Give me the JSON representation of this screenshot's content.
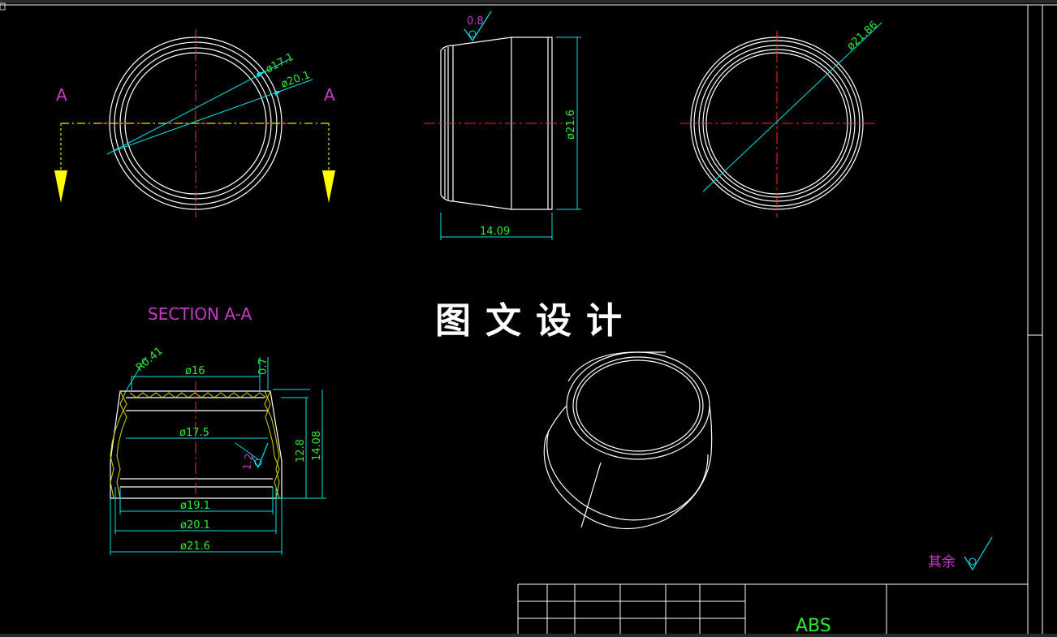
{
  "views": {
    "front": {
      "section_marker": "A",
      "dims": [
        "ø17.1",
        "ø20.1"
      ]
    },
    "side": {
      "roughness": "0.8",
      "dims": [
        "ø21.6",
        "14.09"
      ]
    },
    "back": {
      "dims": [
        "ø21.86"
      ]
    },
    "section": {
      "title": "SECTION A-A",
      "dims": [
        "R0.41",
        "ø16",
        "0.7",
        "ø17.5",
        "1.2",
        "12.8",
        "14.08",
        "ø19.1",
        "ø20.1",
        "ø21.6"
      ]
    }
  },
  "watermark": "图文设计",
  "notes": {
    "roughness_rest": "其余"
  },
  "title_block": {
    "material": "ABS"
  },
  "colors": {
    "background": "#000000",
    "outline": "#ffffff",
    "center_line": "#ff2a2a",
    "dimension": "#00e5e5",
    "dim_text": "#2eea2e",
    "label": "#c73cc7",
    "section_line": "#e8e800",
    "arrow": "#ffff00"
  }
}
